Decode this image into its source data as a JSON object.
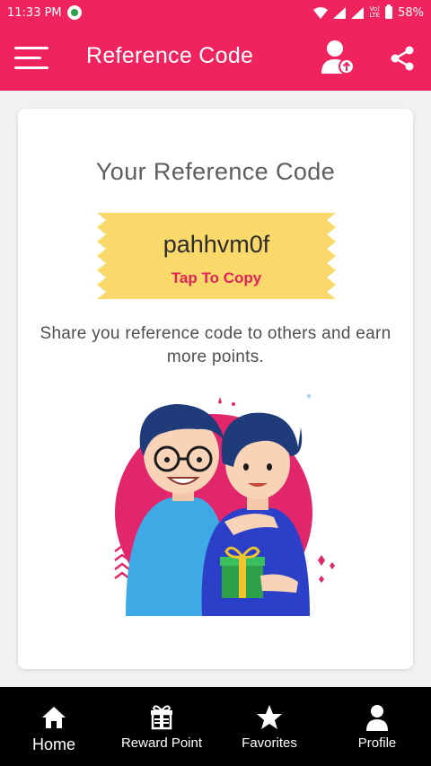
{
  "status_bar": {
    "time": "11:33 PM",
    "network_label": "Vo)\nLTE",
    "battery": "58%"
  },
  "app_bar": {
    "title": "Reference Code",
    "background_color": "#f1235f"
  },
  "card": {
    "title": "Your Reference Code",
    "reference_code": "pahhvm0f",
    "copy_label": "Tap To Copy",
    "description": "Share you reference code to others and earn more points."
  },
  "bottom_nav": {
    "items": [
      {
        "label": "Home",
        "icon": "home-icon"
      },
      {
        "label": "Reward Point",
        "icon": "gift-icon"
      },
      {
        "label": "Favorites",
        "icon": "star-icon"
      },
      {
        "label": "Profile",
        "icon": "profile-icon"
      }
    ]
  },
  "colors": {
    "primary": "#f1235f",
    "ticket": "#fbd86a",
    "accent_text": "#e2235a"
  }
}
